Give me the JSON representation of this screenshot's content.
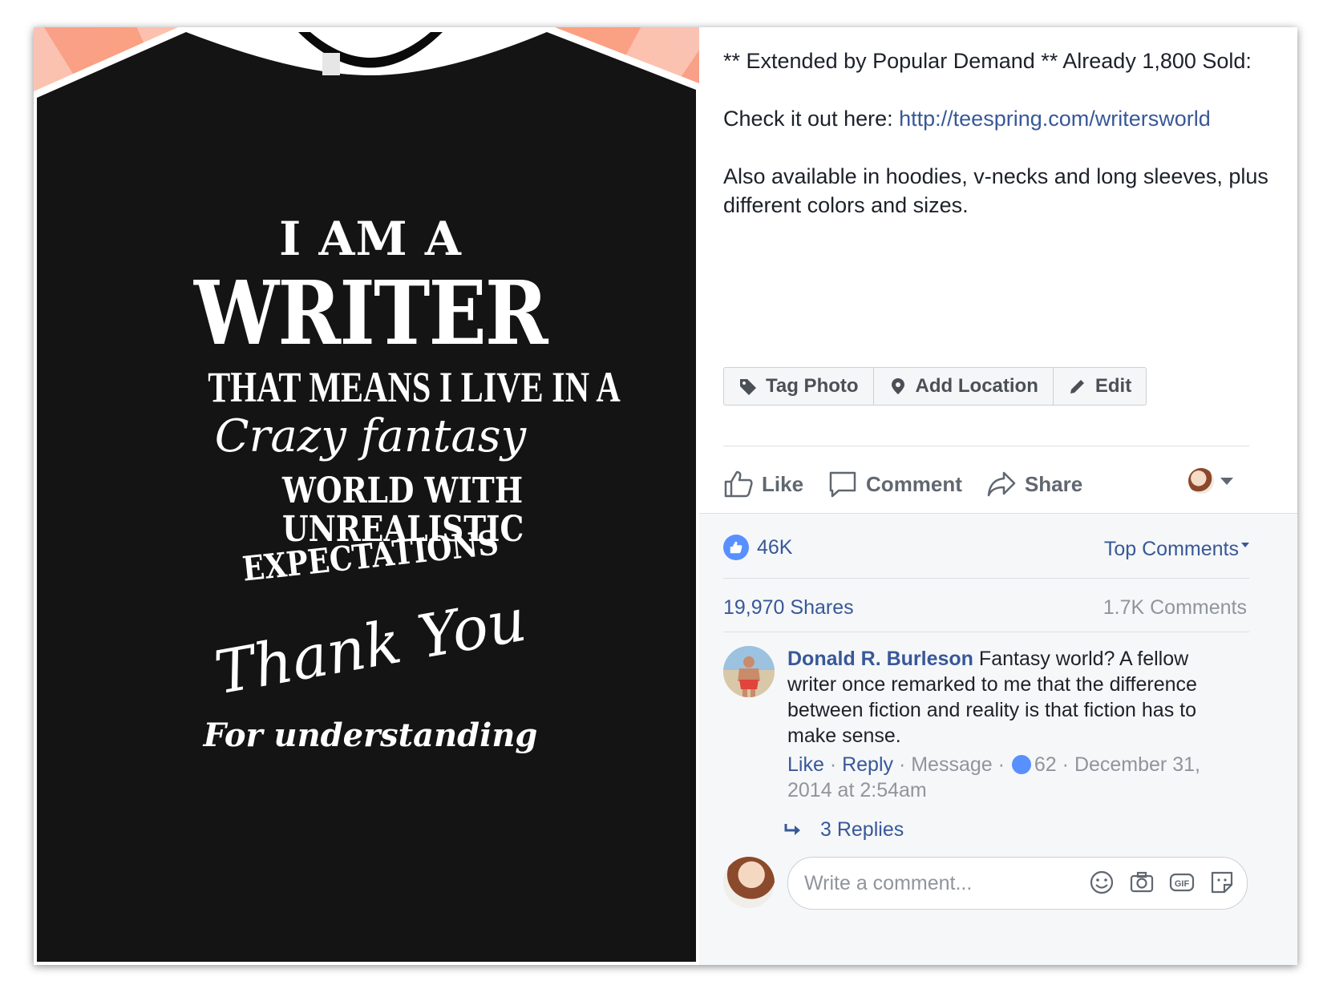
{
  "image": {
    "design_lines": [
      "I AM A",
      "WRITER",
      "THAT MEANS I LIVE IN A",
      "Crazy fantasy",
      "WORLD WITH\nUNREALISTIC",
      "EXPECTATIONS",
      "Thank You",
      "For understanding"
    ]
  },
  "post": {
    "line1": "** Extended by Popular Demand ** Already 1,800 Sold:",
    "line2_prefix": "Check it out here: ",
    "line2_link": "http://teespring.com/writersworld",
    "line3": "Also available in hoodies, v-necks and long sleeves, plus different colors and sizes."
  },
  "photo_actions": {
    "tag": "Tag Photo",
    "location": "Add Location",
    "edit": "Edit"
  },
  "actions": {
    "like": "Like",
    "comment": "Comment",
    "share": "Share"
  },
  "stats": {
    "likes": "46K",
    "sort": "Top Comments",
    "shares": "19,970 Shares",
    "comments": "1.7K Comments"
  },
  "comment": {
    "author": "Donald R. Burleson",
    "text": "Fantasy world? A fellow writer once remarked to me that the difference between fiction and reality is that fiction has to make sense.",
    "like": "Like",
    "reply": "Reply",
    "message": "Message",
    "like_count": "62",
    "date": "December 31, 2014 at 2:54am",
    "replies": "3 Replies"
  },
  "composer": {
    "placeholder": "Write a comment..."
  },
  "colors": {
    "link": "#385898",
    "like_blue": "#5890ff",
    "muted": "#90949c"
  }
}
